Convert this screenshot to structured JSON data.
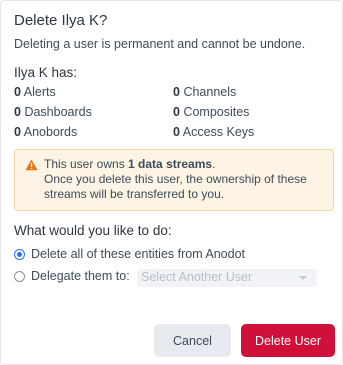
{
  "dialog": {
    "title": "Delete Ilya K?",
    "subtitle": "Deleting a user is permanent and cannot be undone.",
    "entities_title": "Ilya K has:",
    "entities": [
      {
        "count": "0",
        "label": "Alerts"
      },
      {
        "count": "0",
        "label": "Channels"
      },
      {
        "count": "0",
        "label": "Dashboards"
      },
      {
        "count": "0",
        "label": "Composites"
      },
      {
        "count": "0",
        "label": "Anobords"
      },
      {
        "count": "0",
        "label": "Access Keys"
      }
    ],
    "warning": {
      "icon": "warning-triangle-icon",
      "prefix": "This user owns ",
      "bold": "1 data streams",
      "suffix": ".",
      "line2": "Once you delete this user, the ownership of these streams will be transferred to you."
    },
    "question": "What would you like to do:",
    "options": [
      {
        "label": "Delete all of these entities from Anodot",
        "selected": true
      },
      {
        "label": "Delegate them to:",
        "selected": false
      }
    ],
    "select": {
      "placeholder": "Select Another User"
    },
    "buttons": {
      "cancel": "Cancel",
      "delete": "Delete User"
    }
  },
  "colors": {
    "primary_text": "#3d4c59",
    "accent_blue": "#2671ff",
    "danger": "#d0103a",
    "warning_bg": "#fef4e6",
    "warning_border": "#f7d3a3",
    "warning_icon": "#e8750f"
  }
}
